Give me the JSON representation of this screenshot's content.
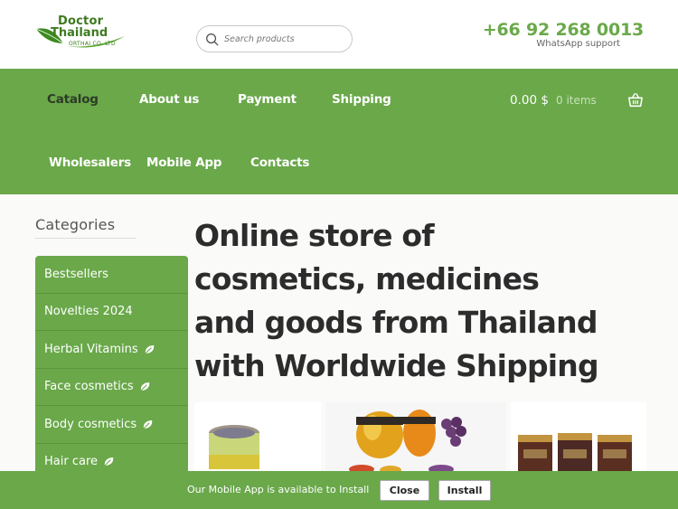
{
  "header": {
    "logo": {
      "line1": "Doctor",
      "line2": "Thailand",
      "tagline": "ORTHAI CO. LTD"
    },
    "search": {
      "placeholder": "Search products",
      "value": "",
      "icon": "search-icon"
    },
    "phone": "+66 92 268 0013",
    "phone_caption": "WhatsApp support"
  },
  "nav": {
    "items": [
      {
        "label": "Catalog",
        "active": true
      },
      {
        "label": "About us"
      },
      {
        "label": "Payment"
      },
      {
        "label": "Shipping"
      },
      {
        "label": "Wholesalers"
      },
      {
        "label": "Mobile App"
      },
      {
        "label": "Contacts"
      }
    ],
    "cart": {
      "total": "0.00 $",
      "count": "0 items",
      "icon": "basket-icon"
    }
  },
  "sidebar": {
    "heading": "Categories",
    "items": [
      {
        "label": "Bestsellers"
      },
      {
        "label": "Novelties 2024"
      },
      {
        "label": "Herbal Vitamins",
        "icon": "leaf-icon"
      },
      {
        "label": "Face cosmetics",
        "icon": "leaf-icon"
      },
      {
        "label": "Body cosmetics",
        "icon": "leaf-icon"
      },
      {
        "label": "Hair care",
        "icon": "leaf-icon"
      }
    ]
  },
  "main": {
    "title": "Online store of cosmetics, medicines and goods from Thailand with Worldwide Shipping"
  },
  "banner": {
    "text": "Our Mobile App is available to Install",
    "close_label": "Close",
    "install_label": "Install"
  },
  "colors": {
    "brand_green": "#6aa84a",
    "dark_green": "#3d7a1f",
    "active_nav": "#2d3b26"
  }
}
